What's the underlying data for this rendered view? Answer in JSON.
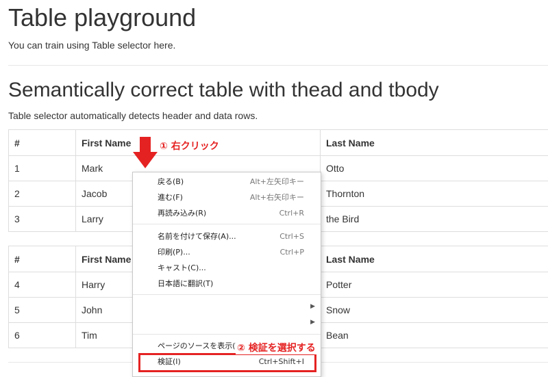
{
  "header": {
    "title": "Table playground",
    "subtitle": "You can train using Table selector here."
  },
  "section": {
    "title": "Semantically correct table with thead and tbody",
    "description": "Table selector automatically detects header and data rows."
  },
  "table1": {
    "headers": [
      "#",
      "First Name",
      "Last Name"
    ],
    "rows": [
      [
        "1",
        "Mark",
        "Otto"
      ],
      [
        "2",
        "Jacob",
        "Thornton"
      ],
      [
        "3",
        "Larry",
        "the Bird"
      ]
    ]
  },
  "table2": {
    "headers": [
      "#",
      "First Name",
      "Last Name"
    ],
    "rows": [
      [
        "4",
        "Harry",
        "Potter"
      ],
      [
        "5",
        "John",
        "Snow"
      ],
      [
        "6",
        "Tim",
        "Bean"
      ]
    ]
  },
  "context_menu": {
    "back": {
      "label": "戻る(B)",
      "shortcut": "Alt+左矢印キー"
    },
    "forward": {
      "label": "進む(F)",
      "shortcut": "Alt+右矢印キー"
    },
    "reload": {
      "label": "再読み込み(R)",
      "shortcut": "Ctrl+R"
    },
    "save_as": {
      "label": "名前を付けて保存(A)...",
      "shortcut": "Ctrl+S"
    },
    "print": {
      "label": "印刷(P)...",
      "shortcut": "Ctrl+P"
    },
    "cast": {
      "label": "キャスト(C)..."
    },
    "translate": {
      "label": "日本語に翻訳(T)"
    },
    "view_source": {
      "label": "ページのソースを表示(V)"
    },
    "inspect": {
      "label": "検証(I)",
      "shortcut": "Ctrl+Shift+I"
    }
  },
  "annotations": {
    "step1": "① 右クリック",
    "step2": "② 検証を選択する",
    "color": "#e52222"
  }
}
